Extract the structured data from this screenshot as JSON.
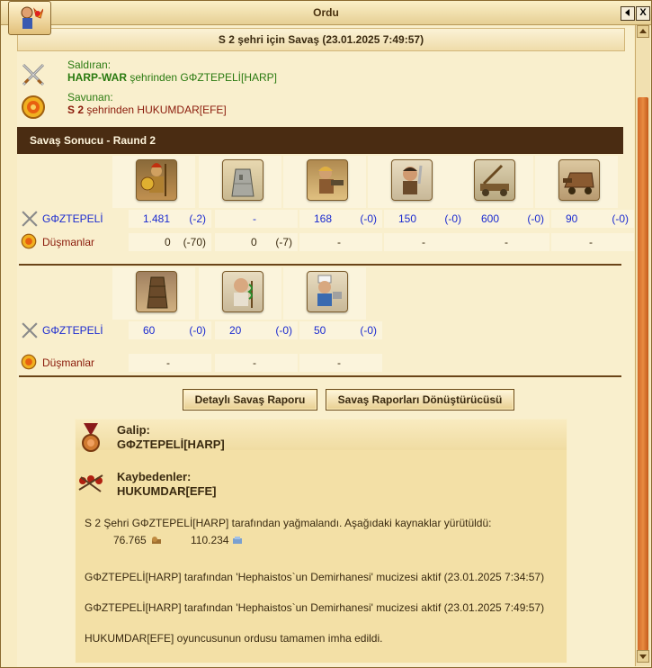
{
  "window": {
    "title": "Ordu",
    "back_icon": "back-arrow-icon",
    "close_label": "X"
  },
  "report": {
    "heading": "S 2 şehri için Savaş (23.01.2025 7:49:57)",
    "attacker": {
      "label": "Saldıran:",
      "city": "HARP-WAR",
      "from_text": "şehrinden",
      "player": "GΦZTEPELİ[HARP]"
    },
    "defender": {
      "label": "Savunan:",
      "city": "S 2",
      "from_text": "şehrinden",
      "player": "HUKUMDAR[EFE]"
    },
    "result_title": "Savaş Sonucu - Raund 2"
  },
  "units_row1": [
    {
      "icon": "hoplite-icon",
      "own": "1.481",
      "own_loss": "(-2)",
      "enemy": "0",
      "enemy_loss": "(-70)"
    },
    {
      "icon": "city-wall-icon",
      "own": "-",
      "own_loss": "",
      "enemy": "0",
      "enemy_loss": "(-7)"
    },
    {
      "icon": "slinger-icon",
      "own": "168",
      "own_loss": "(-0)",
      "enemy": "-",
      "enemy_loss": ""
    },
    {
      "icon": "swordsman-icon",
      "own": "150",
      "own_loss": "(-0)",
      "enemy": "-",
      "enemy_loss": ""
    },
    {
      "icon": "catapult-icon",
      "own": "600",
      "own_loss": "(-0)",
      "enemy": "-",
      "enemy_loss": ""
    },
    {
      "icon": "ram-icon",
      "own": "90",
      "own_loss": "(-0)",
      "enemy": "-",
      "enemy_loss": ""
    }
  ],
  "units_row2": [
    {
      "icon": "siege-tower-icon",
      "own": "60",
      "own_loss": "(-0)",
      "enemy": "-",
      "enemy_loss": ""
    },
    {
      "icon": "doctor-icon",
      "own": "20",
      "own_loss": "(-0)",
      "enemy": "-",
      "enemy_loss": ""
    },
    {
      "icon": "cook-icon",
      "own": "50",
      "own_loss": "(-0)",
      "enemy": "-",
      "enemy_loss": ""
    }
  ],
  "side_labels": {
    "own": "GΦZTEPELİ",
    "enemies": "Düşmanlar"
  },
  "buttons": {
    "detailed": "Detaylı Savaş Raporu",
    "converter": "Savaş Raporları Dönüştürücüsü"
  },
  "summary": {
    "winner_label": "Galip:",
    "winner": "GΦZTEPELİ[HARP]",
    "losers_label": "Kaybedenler:",
    "loser": "HUKUMDAR[EFE]",
    "plunder_text": "S 2 Şehri GΦZTEPELİ[HARP] tarafından yağmalandı. Aşağıdaki kaynaklar yürütüldü:",
    "res1": "76.765",
    "res2": "110.234",
    "miracle1": "GΦZTEPELİ[HARP] tarafından 'Hephaistos`un Demirhanesi' mucizesi aktif (23.01.2025 7:34:57)",
    "miracle2": "GΦZTEPELİ[HARP] tarafından 'Hephaistos`un Demirhanesi' mucizesi aktif (23.01.2025 7:49:57)",
    "destroyed": "HUKUMDAR[EFE] oyuncusunun ordusu tamamen imha edildi."
  },
  "colors": {
    "header_bar": "#4a2c12",
    "number_blue": "#1a2ad0",
    "winner_green": "#2a7a10",
    "scroll_thumb": "#d26a2a"
  }
}
